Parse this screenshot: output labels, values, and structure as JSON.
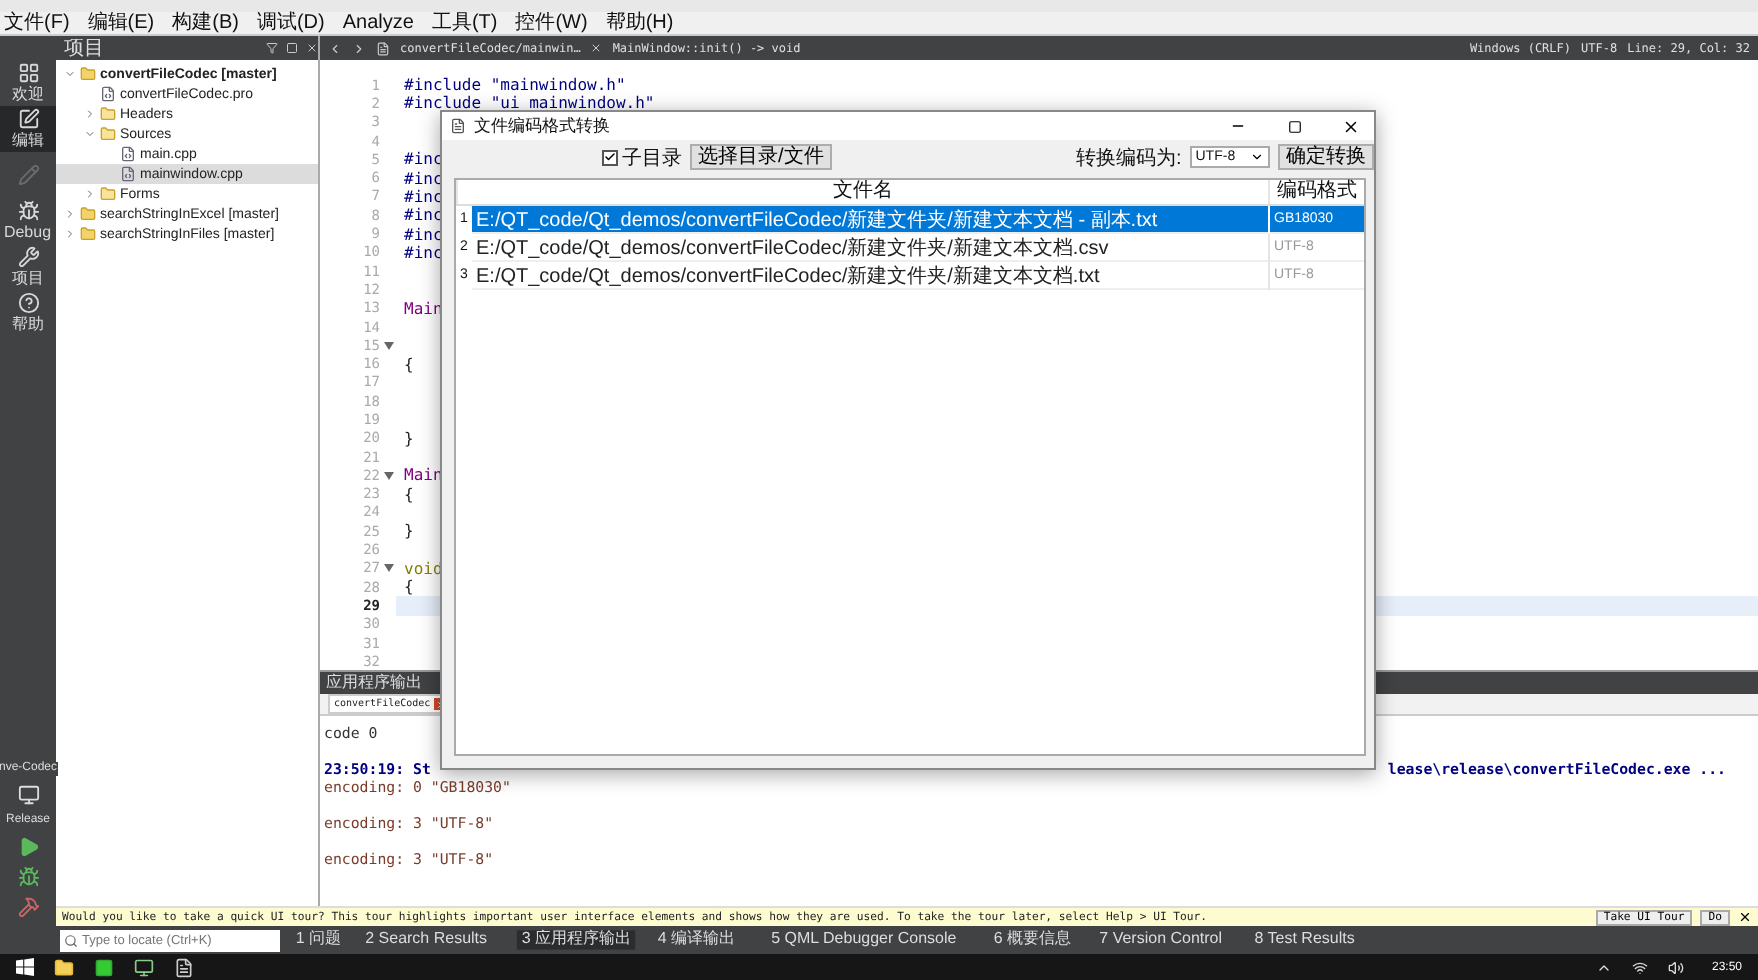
{
  "menu": [
    "文件(F)",
    "编辑(E)",
    "构建(B)",
    "调试(D)",
    "Analyze",
    "工具(T)",
    "控件(W)",
    "帮助(H)"
  ],
  "modes": [
    {
      "label": "欢迎",
      "kind": "welcome",
      "selected": false,
      "disabled": false
    },
    {
      "label": "编辑",
      "kind": "edit",
      "selected": true,
      "disabled": false
    },
    {
      "kind": "design",
      "selected": false,
      "disabled": true
    },
    {
      "label": "Debug",
      "kind": "debug",
      "selected": false,
      "disabled": false
    },
    {
      "label": "项目",
      "kind": "projects",
      "selected": false,
      "disabled": false
    },
    {
      "label": "帮助",
      "kind": "help",
      "selected": false,
      "disabled": false
    }
  ],
  "kit": {
    "project": "nve-Codec",
    "config": "Release"
  },
  "project_panel": {
    "title": "项目",
    "tree": [
      {
        "name": "convertFileCodec [master]",
        "kind": "project",
        "active": true,
        "expanded": true,
        "selected": false,
        "children": [
          {
            "name": "convertFileCodec.pro",
            "kind": "file",
            "selected": false
          },
          {
            "name": "Headers",
            "kind": "folder",
            "expanded": false,
            "selected": false
          },
          {
            "name": "Sources",
            "kind": "folder",
            "expanded": true,
            "selected": false,
            "children": [
              {
                "name": "main.cpp",
                "kind": "file",
                "selected": false
              },
              {
                "name": "mainwindow.cpp",
                "kind": "file",
                "selected": true
              }
            ]
          },
          {
            "name": "Forms",
            "kind": "folder",
            "expanded": false,
            "selected": false
          }
        ]
      },
      {
        "name": "searchStringInExcel [master]",
        "kind": "project",
        "active": false,
        "expanded": false,
        "selected": false
      },
      {
        "name": "searchStringInFiles [master]",
        "kind": "project",
        "active": false,
        "expanded": false,
        "selected": false
      }
    ]
  },
  "editor": {
    "file_tab": "convertFileCodec/mainwin…",
    "symbol": "MainWindow::init() -> void",
    "line_ending": "Windows (CRLF)",
    "encoding": "UTF-8",
    "position": "Line: 29, Col: 32",
    "lines": [
      {
        "n": "1",
        "text": "#include \"mainwindow.h\"",
        "kind": "preprocessor",
        "current": false
      },
      {
        "n": "2",
        "text": "#include \"ui_mainwindow.h\"",
        "kind": "preprocessor",
        "current": false
      },
      {
        "n": "3",
        "current": false
      },
      {
        "n": "4",
        "current": false
      },
      {
        "n": "5",
        "text": "#inc",
        "kind": "preprocessor",
        "current": false
      },
      {
        "n": "6",
        "text": "#inc",
        "kind": "preprocessor",
        "current": false
      },
      {
        "n": "7",
        "text": "#inc",
        "kind": "preprocessor",
        "current": false
      },
      {
        "n": "8",
        "text": "#inc",
        "kind": "preprocessor",
        "current": false
      },
      {
        "n": "9",
        "text": "#inc",
        "kind": "preprocessor",
        "current": false
      },
      {
        "n": "10",
        "text": "#inc",
        "kind": "preprocessor",
        "current": false
      },
      {
        "n": "11",
        "current": false
      },
      {
        "n": "12",
        "current": false
      },
      {
        "n": "13",
        "text": "Main",
        "kind": "type",
        "current": false
      },
      {
        "n": "14",
        "current": false
      },
      {
        "n": "15",
        "fold": true,
        "current": false
      },
      {
        "n": "16",
        "text": "{",
        "kind": "plain",
        "current": false
      },
      {
        "n": "17",
        "current": false
      },
      {
        "n": "18",
        "current": false
      },
      {
        "n": "19",
        "current": false
      },
      {
        "n": "20",
        "text": "}",
        "kind": "plain",
        "current": false
      },
      {
        "n": "21",
        "current": false
      },
      {
        "n": "22",
        "text": "Main",
        "kind": "type",
        "fold": true,
        "current": false
      },
      {
        "n": "23",
        "text": "{",
        "kind": "plain",
        "current": false
      },
      {
        "n": "24",
        "current": false
      },
      {
        "n": "25",
        "text": "}",
        "kind": "plain",
        "current": false
      },
      {
        "n": "26",
        "current": false
      },
      {
        "n": "27",
        "text": "void",
        "kind": "keyword",
        "fold": true,
        "current": false
      },
      {
        "n": "28",
        "text": "{",
        "kind": "plain",
        "current": false
      },
      {
        "n": "29",
        "current": true
      },
      {
        "n": "30",
        "current": false
      },
      {
        "n": "31",
        "current": false
      },
      {
        "n": "32",
        "current": false
      }
    ]
  },
  "dialog": {
    "title": "文件编码格式转换",
    "subdir": {
      "label": "子目录",
      "checked": true
    },
    "choose_button": "选择目录/文件",
    "target_label": "转换编码为:",
    "target_value": "UTF-8",
    "convert_button": "确定转换",
    "columns": [
      "文件名",
      "编码格式"
    ],
    "rows": [
      {
        "index": "1",
        "path": "E:/QT_code/Qt_demos/convertFileCodec/新建文件夹/新建文本文档 - 副本.txt",
        "encoding": "GB18030",
        "selected": true
      },
      {
        "index": "2",
        "path": "E:/QT_code/Qt_demos/convertFileCodec/新建文件夹/新建文本文档.csv",
        "encoding": "UTF-8",
        "selected": false
      },
      {
        "index": "3",
        "path": "E:/QT_code/Qt_demos/convertFileCodec/新建文件夹/新建文本文档.txt",
        "encoding": "UTF-8",
        "selected": false
      }
    ]
  },
  "output": {
    "title": "应用程序输出",
    "tab": "convertFileCodec",
    "lines": [
      {
        "text": "code 0",
        "kind": "plain"
      },
      {
        "text": "23:50:19: St",
        "text_right": "lease\\release\\convertFileCodec.exe ...",
        "kind": "status",
        "spaced": true
      },
      {
        "text": "encoding: 0 \"GB18030\"",
        "kind": "debug"
      },
      {
        "text": "encoding: 3 \"UTF-8\"",
        "kind": "debug",
        "spaced": true
      },
      {
        "text": "encoding: 3 \"UTF-8\"",
        "kind": "debug",
        "spaced": true
      }
    ]
  },
  "tour": {
    "message": "Would you like to take a quick UI tour? This tour highlights important user interface elements and shows how they are used. To take the tour later, select Help > UI Tour.",
    "buttons": [
      "Take UI Tour",
      "Do"
    ]
  },
  "status_bar": {
    "locate_placeholder": "Type to locate (Ctrl+K)",
    "panes": [
      {
        "label": "1 问题",
        "selected": false
      },
      {
        "label": "2 Search Results",
        "selected": false
      },
      {
        "label": "3 应用程序输出",
        "selected": true
      },
      {
        "label": "4 编译输出",
        "selected": false
      },
      {
        "label": "5 QML Debugger Console",
        "selected": false
      },
      {
        "label": "6 概要信息",
        "selected": false
      },
      {
        "label": "7 Version Control",
        "selected": false
      },
      {
        "label": "8 Test Results",
        "selected": false
      }
    ]
  },
  "taskbar": {
    "clock": "23:50"
  }
}
